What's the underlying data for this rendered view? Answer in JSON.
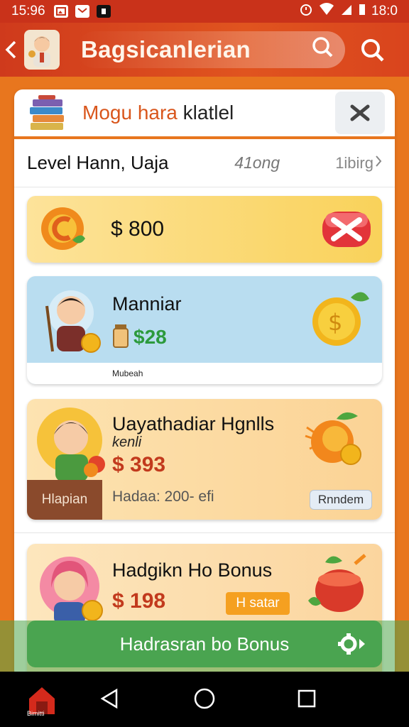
{
  "status_bar": {
    "time": "15:96",
    "battery": "18:0"
  },
  "app_bar": {
    "title": "Bagsicanlerian"
  },
  "card": {
    "title_part1": "Mogu hara",
    "title_part2": "klatlel",
    "level_label": "Level Hann, Uaja",
    "level_mid": "41ong",
    "level_right": "1ibirg"
  },
  "items": [
    {
      "price": "$ 800"
    },
    {
      "name": "Manniar",
      "price": "$28",
      "footer": "Mubeah"
    },
    {
      "name": "Uayathadiar Hgnlls",
      "subtitle": "kenli",
      "price": "$ 393",
      "tag": "Hlapian",
      "desc": "Hadaa: 200- efi",
      "button": "Rnndem"
    },
    {
      "name": "Hadgikn Ho Bonus",
      "price": "$ 198",
      "button": "H satar"
    }
  ],
  "bonus_button": "Hadrasran bo Bonus",
  "nav": {
    "app_label": "Bimitti"
  },
  "colors": {
    "primary": "#d9441d",
    "accent": "#e8761e",
    "green": "#4aa450",
    "price_red": "#c23a1d",
    "price_green": "#2c9a3c"
  }
}
